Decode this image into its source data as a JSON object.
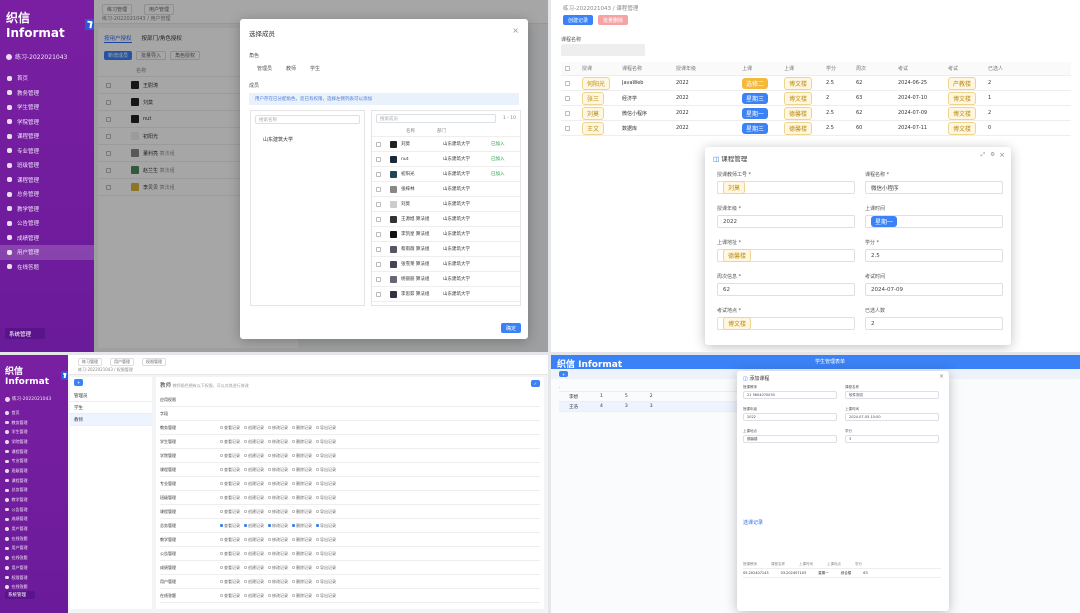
{
  "app": {
    "brand": "织信 Informat",
    "user": "练习-2022021043"
  },
  "q1": {
    "menu": [
      "首页",
      "教务管理",
      "学生管理",
      "学院管理",
      "课程管理",
      "专业管理",
      "班级管理",
      "课程管理",
      "总务管理",
      "教学管理",
      "公告管理",
      "成绩管理",
      "用户管理",
      "在线答题"
    ],
    "sys_btn": "系统管理",
    "tabs": [
      "练习管理",
      "用户管理"
    ],
    "crumb": "练习-2022021043 / 用户管理",
    "sub_tabs": [
      "按用户授权",
      "按部门/角色授权"
    ],
    "buttons": [
      "新增成员",
      "批量导入",
      "角色授权"
    ],
    "table_head": "名称",
    "rows": [
      {
        "name": "王尉涛",
        "tag": ""
      },
      {
        "name": "刘莫",
        "tag": ""
      },
      {
        "name": "nut",
        "tag": ""
      },
      {
        "name": "初阳光",
        "tag": ""
      },
      {
        "name": "董利亮",
        "tag": "算法组"
      },
      {
        "name": "赵兰生",
        "tag": "算法组"
      },
      {
        "name": "李贝贝",
        "tag": "算法组"
      }
    ],
    "modal": {
      "title": "选择成员",
      "scope_label": "角色",
      "scope_opts": [
        "管理员",
        "教师",
        "学生"
      ],
      "member_label": "成员",
      "hint": "用户存在已分配角色，您已有权限，选择左侧列表可以添加",
      "search_ph": "搜索名称",
      "dept": "山东建筑大学",
      "search2_ph": "搜索成员",
      "page": "1 - 10",
      "cols": [
        "名称",
        "部门"
      ],
      "members": [
        {
          "name": "刘莫",
          "dept": "山东建筑大学",
          "status": "已加入"
        },
        {
          "name": "nut",
          "dept": "山东建筑大学",
          "status": "已加入"
        },
        {
          "name": "初阳光",
          "dept": "山东建筑大学",
          "status": "已加入"
        },
        {
          "name": "张梓林",
          "dept": "山东建筑大学",
          "status": ""
        },
        {
          "name": "刘莫",
          "dept": "山东建筑大学",
          "status": ""
        },
        {
          "name": "王源旭 算法组",
          "dept": "山东建筑大学",
          "status": ""
        },
        {
          "name": "李凯星 算法组",
          "dept": "山东建筑大学",
          "status": ""
        },
        {
          "name": "蔡雨薇 算法组",
          "dept": "山东建筑大学",
          "status": ""
        },
        {
          "name": "张雪莱 算法组",
          "dept": "山东建筑大学",
          "status": ""
        },
        {
          "name": "杨丽丽 算法组",
          "dept": "山东建筑大学",
          "status": ""
        },
        {
          "name": "李思茹 算法组",
          "dept": "山东建筑大学",
          "status": ""
        }
      ],
      "ok": "确定"
    }
  },
  "q2": {
    "crumb": "练习-2022021043 / 课程管理",
    "buttons": [
      "创建记录",
      "批量删除"
    ],
    "filter_label": "课程名称",
    "columns": [
      "授课",
      "课程名称",
      "授课年级",
      "上课",
      "上课",
      "学分",
      "周次",
      "考试",
      "考试",
      "已选人"
    ],
    "rows": [
      {
        "t": "何阳光",
        "c": "JavaWeb",
        "y": "2022",
        "chip": "选修二",
        "chipc": "o",
        "loc": "博文楼",
        "cr": "2.5",
        "w": "62",
        "d": "2024-06-25",
        "e": "产教楼",
        "n": "2"
      },
      {
        "t": "张三",
        "c": "经济学",
        "y": "2022",
        "chip": "星期三",
        "chipc": "b",
        "loc": "博文楼",
        "cr": "2",
        "w": "63",
        "d": "2024-07-10",
        "e": "博文楼",
        "n": "1"
      },
      {
        "t": "刘莫",
        "c": "微信小程序",
        "y": "2022",
        "chip": "星期一",
        "chipc": "b",
        "loc": "德馨楼",
        "cr": "2.5",
        "w": "62",
        "d": "2024-07-09",
        "e": "博文楼",
        "n": "2"
      },
      {
        "t": "王文",
        "c": "数据库",
        "y": "2022",
        "chip": "星期三",
        "chipc": "b",
        "loc": "德馨楼",
        "cr": "2.5",
        "w": "60",
        "d": "2024-07-11",
        "e": "博文楼",
        "n": "0"
      }
    ],
    "modal": {
      "title": "课程管理",
      "fields": [
        {
          "label": "授课教师工号 *",
          "value": "刘莫"
        },
        {
          "label": "课程名称 *",
          "value": "微信小程序"
        },
        {
          "label": "授课年级 *",
          "value": "2022"
        },
        {
          "label": "上课时间",
          "value": "星期一"
        },
        {
          "label": "上课地址 *",
          "value": "德馨楼"
        },
        {
          "label": "学分 *",
          "value": "2.5"
        },
        {
          "label": "周次信息 *",
          "value": "62"
        },
        {
          "label": "考试时间",
          "value": "2024-07-09"
        },
        {
          "label": "考试地点 *",
          "value": "博文楼"
        },
        {
          "label": "已选人数",
          "value": "2"
        }
      ]
    }
  },
  "q3": {
    "menu": [
      "首页",
      "教务管理",
      "学生管理",
      "学院管理",
      "课程管理",
      "专业管理",
      "班级管理",
      "课程管理",
      "总务管理",
      "教学管理",
      "公告管理",
      "成绩管理",
      "用户管理",
      "在线答题",
      "用户管理",
      "在线答题",
      "用户管理",
      "权限管理",
      "在线答题"
    ],
    "sys_btn": "系统管理",
    "tabs": [
      "练习管理",
      "用户管理",
      "权限管理"
    ],
    "crumb": "练习-2022021043 / 权限管理",
    "left_items": [
      "管理员",
      "学生",
      "教师"
    ],
    "panel_title": "教师",
    "panel_desc": "教师角色拥有以下权限，可以对其进行修改",
    "perm_rows": [
      "应用权限",
      "字段",
      "教务管理",
      "学生管理",
      "学院管理",
      "课程管理",
      "专业管理",
      "班级管理",
      "课程管理",
      "总务管理",
      "教学管理",
      "公告管理",
      "成绩管理",
      "用户管理",
      "在线答题"
    ],
    "perm_cols": [
      "查看记录",
      "创建记录",
      "修改记录",
      "删除记录",
      "导出记录"
    ]
  },
  "q4": {
    "tab": "学生管理表单",
    "modal_title": "添加课程",
    "fields": [
      {
        "label": "授课教师",
        "value": "21 5604070030"
      },
      {
        "label": "课程名称",
        "value": "软件测试"
      },
      {
        "label": "授课年级",
        "value": "2022"
      },
      {
        "label": "上课时间",
        "value": "2024-07-05 10:00"
      },
      {
        "label": "上课地点",
        "value": "德馨楼"
      },
      {
        "label": "学分",
        "value": "3"
      }
    ],
    "section": "选课记录",
    "sub_cols": [
      "授课教师",
      "课程名称",
      "上课时间",
      "上课地点",
      "学分"
    ],
    "sub_row": [
      "05.202407143",
      "03.202407103",
      "星期一",
      "综合楼",
      "63"
    ],
    "rows": [
      {
        "a": "李想",
        "b": "1",
        "c": "5",
        "d": "2"
      },
      {
        "a": "王浩",
        "b": "4",
        "c": "3",
        "d": "3"
      }
    ]
  }
}
